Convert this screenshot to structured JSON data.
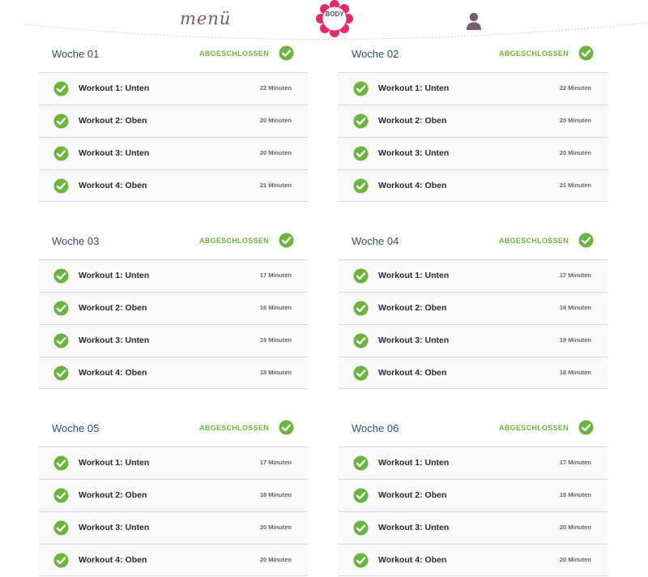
{
  "header": {
    "menu_label": "menü",
    "logo_text_line1": "BODY",
    "logo_text_line2": "",
    "icons": {
      "user": "user-icon",
      "logo": "flower-logo-icon",
      "check": "check-circle-icon"
    }
  },
  "colors": {
    "accent": "#6db33f",
    "title": "#2f4d6e",
    "logo": "#e8286e",
    "menu": "#7a5a6e"
  },
  "weeks": [
    {
      "title": "Woche 01",
      "status": "ABGESCHLOSSEN",
      "workouts": [
        {
          "label": "Workout 1: Unten",
          "duration": "22 Minuten"
        },
        {
          "label": "Workout 2: Oben",
          "duration": "20 Minuten"
        },
        {
          "label": "Workout 3: Unten",
          "duration": "20 Minuten"
        },
        {
          "label": "Workout 4: Oben",
          "duration": "21 Minuten"
        }
      ]
    },
    {
      "title": "Woche 02",
      "status": "ABGESCHLOSSEN",
      "workouts": [
        {
          "label": "Workout 1: Unten",
          "duration": "22 Minuten"
        },
        {
          "label": "Workout 2: Oben",
          "duration": "20 Minuten"
        },
        {
          "label": "Workout 3: Unten",
          "duration": "20 Minuten"
        },
        {
          "label": "Workout 4: Oben",
          "duration": "21 Minuten"
        }
      ]
    },
    {
      "title": "Woche 03",
      "status": "ABGESCHLOSSEN",
      "workouts": [
        {
          "label": "Workout 1: Unten",
          "duration": "17 Minuten"
        },
        {
          "label": "Workout 2: Oben",
          "duration": "16 Minuten"
        },
        {
          "label": "Workout 3: Unten",
          "duration": "19 Minuten"
        },
        {
          "label": "Workout 4: Oben",
          "duration": "18 Minuten"
        }
      ]
    },
    {
      "title": "Woche 04",
      "status": "ABGESCHLOSSEN",
      "workouts": [
        {
          "label": "Workout 1: Unten",
          "duration": "17 Minuten"
        },
        {
          "label": "Workout 2: Oben",
          "duration": "16 Minuten"
        },
        {
          "label": "Workout 3: Unten",
          "duration": "19 Minuten"
        },
        {
          "label": "Workout 4: Oben",
          "duration": "18 Minuten"
        }
      ]
    },
    {
      "title": "Woche 05",
      "status": "ABGESCHLOSSEN",
      "workouts": [
        {
          "label": "Workout 1: Unten",
          "duration": "17 Minuten"
        },
        {
          "label": "Workout 2: Oben",
          "duration": "18 Minuten"
        },
        {
          "label": "Workout 3: Unten",
          "duration": "20 Minuten"
        },
        {
          "label": "Workout 4: Oben",
          "duration": "20 Minuten"
        }
      ]
    },
    {
      "title": "Woche 06",
      "status": "ABGESCHLOSSEN",
      "workouts": [
        {
          "label": "Workout 1: Unten",
          "duration": "17 Minuten"
        },
        {
          "label": "Workout 2: Oben",
          "duration": "18 Minuten"
        },
        {
          "label": "Workout 3: Unten",
          "duration": "20 Minuten"
        },
        {
          "label": "Workout 4: Oben",
          "duration": "20 Minuten"
        }
      ]
    }
  ]
}
